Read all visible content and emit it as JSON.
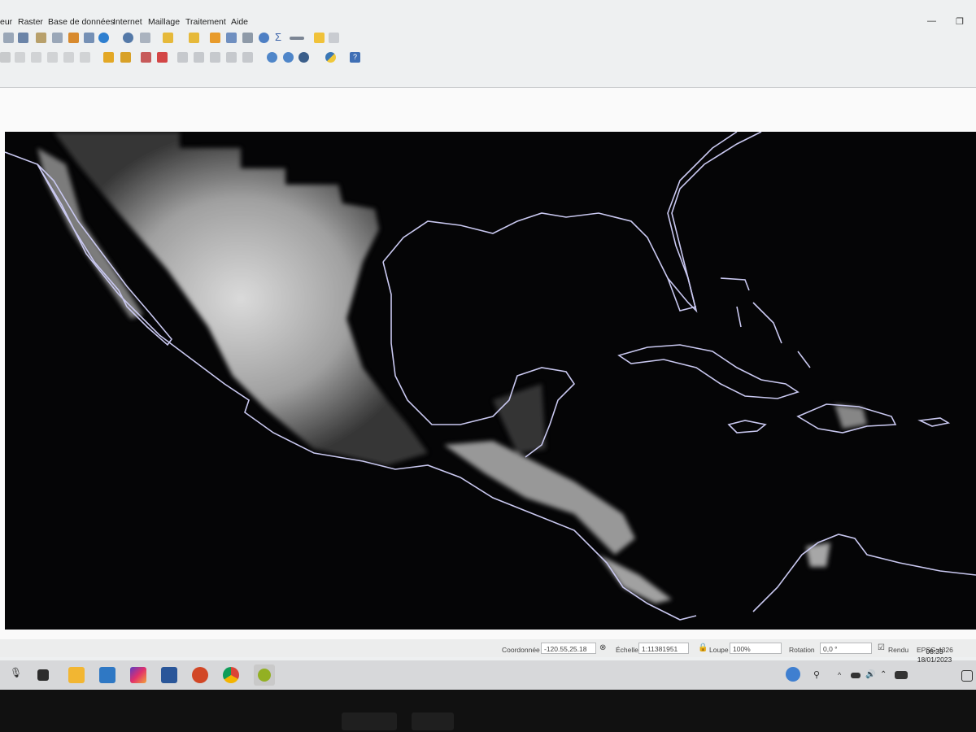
{
  "menubar": {
    "items": [
      "eur",
      "Raster",
      "Base de données",
      "Internet",
      "Maillage",
      "Traitement",
      "Aide"
    ]
  },
  "toolbar": {
    "row1_icons": [
      "pan-icon",
      "zoom-in-icon",
      "zoom-layer-icon",
      "zoom-native-icon",
      "refresh-icon",
      "identify-icon",
      "settings-icon",
      "select-icon",
      "attribute-table-icon",
      "calculator-icon",
      "sum-icon",
      "measure-icon",
      "annotation-icon",
      "text-icon"
    ],
    "row2_icons": [
      "edit-icon",
      "digitize-icon",
      "node-icon",
      "label-icon",
      "label-move-icon",
      "label-rotate-icon",
      "python-icon",
      "help-icon"
    ]
  },
  "statusbar": {
    "coord_label": "Coordonnée",
    "coord_value": "-120.55,25.18",
    "scale_label": "Échelle",
    "scale_value": "1:11381951",
    "magnifier_label": "Loupe",
    "magnifier_value": "100%",
    "rotation_label": "Rotation",
    "rotation_value": "0,0 °",
    "render_label": "Rendu",
    "crs_label": "EPSG:4326"
  },
  "taskbar": {
    "apps": [
      "mic-icon",
      "task-view-icon",
      "file-explorer-icon",
      "mail-icon",
      "instagram-icon",
      "word-icon",
      "powerpoint-icon",
      "chrome-icon",
      "qgis-icon"
    ]
  },
  "tray": {
    "time": "08:33",
    "date": "18/01/2023"
  },
  "colors": {
    "map_background": "#050506",
    "coastline": "#c9c8f0",
    "accent_qgis": "#93b023"
  }
}
